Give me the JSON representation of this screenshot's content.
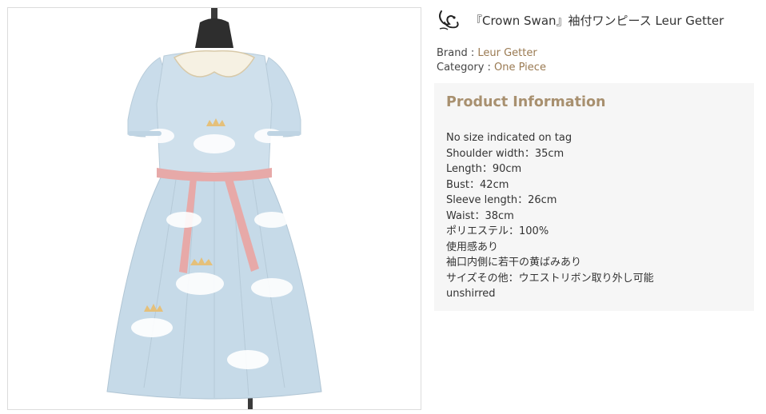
{
  "product": {
    "title": "『Crown Swan』袖付ワンピース Leur Getter",
    "image_alt": "Crown Swan short-sleeve one piece dress, light blue with swan and crown print, cream peter pan collar, pink waist ribbon",
    "logo_icon": "brand-logo-icon"
  },
  "meta": {
    "brand_label": "Brand : ",
    "brand_value": "Leur Getter",
    "category_label": "Category : ",
    "category_value": "One Piece"
  },
  "info": {
    "heading": "Product Information",
    "lines": [
      "No size indicated on tag",
      "Shoulder width：35cm",
      "Length：90cm",
      "Bust：42cm",
      "Sleeve length：26cm",
      "Waist：38cm",
      "ポリエステル：100%",
      "使用感あり",
      "袖口内側に若干の黄ばみあり",
      "サイズその他：ウエストリボン取り外し可能",
      "unshirred"
    ]
  },
  "colors": {
    "link": "#9a7a52",
    "heading": "#a8906f",
    "panel_bg": "#f6f6f6",
    "dress_blue": "#c9dcea",
    "ribbon_pink": "#e7a9a8",
    "collar_cream": "#f6f1e3"
  }
}
